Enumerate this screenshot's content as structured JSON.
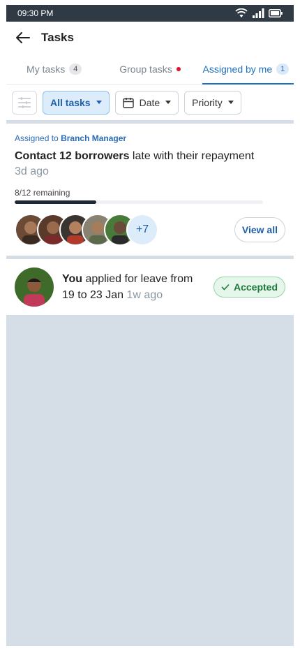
{
  "status": {
    "time": "09:30 PM"
  },
  "appbar": {
    "title": "Tasks"
  },
  "tabs": [
    {
      "label": "My tasks",
      "count": "4"
    },
    {
      "label": "Group tasks"
    },
    {
      "label": "Assigned by me",
      "count": "1"
    }
  ],
  "filters": {
    "all_tasks": "All tasks",
    "date": "Date",
    "priority": "Priority"
  },
  "task_card": {
    "assigned_prefix": "Assigned to",
    "assigned_to": "Branch Manager",
    "title_bold": "Contact 12 borrowers",
    "title_rest": " late with their repayment",
    "time": "3d ago",
    "remaining": "8/12 remaining",
    "progress_fraction": 0.33,
    "more_count": "+7",
    "view_all": "View all"
  },
  "leave_card": {
    "subject": "You",
    "text_a": " applied for leave from",
    "text_b": "19 to 23 Jan ",
    "time": "1w ago",
    "status": "Accepted"
  },
  "colors": {
    "accent": "#1f6fbf",
    "accepted_bg": "#e6f6ea",
    "accepted_text": "#1e7a3b",
    "notification_dot": "#e0102a"
  }
}
